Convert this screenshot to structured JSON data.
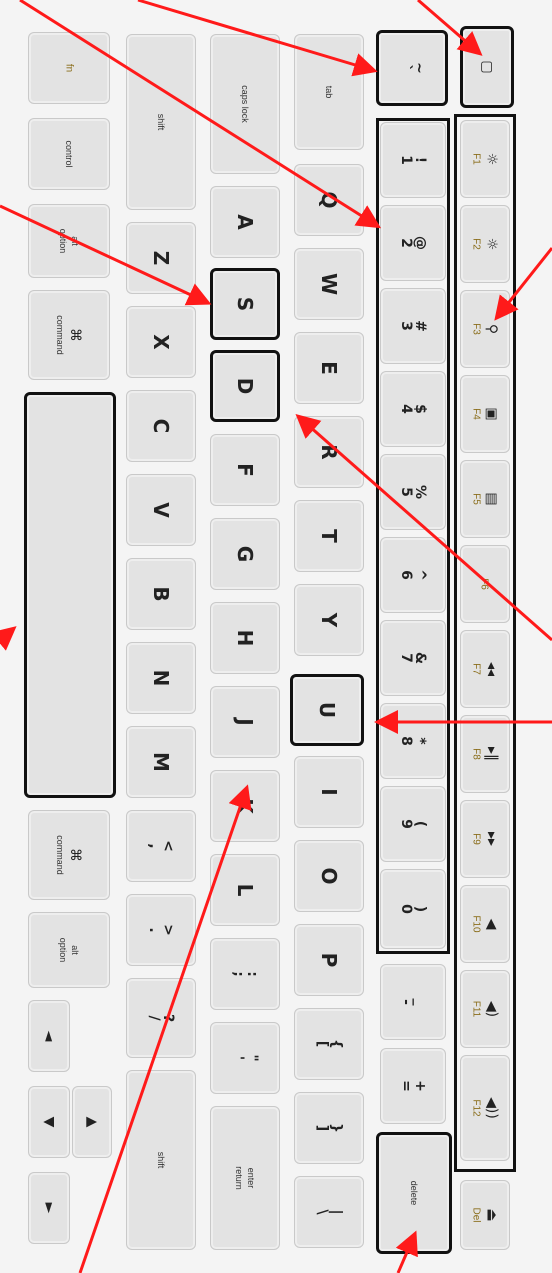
{
  "colors": {
    "arrow": "#ff1a1a",
    "outline": "#111111",
    "key_face": "#e3e3e3",
    "fn_label": "#8a6d1a"
  },
  "keys": {
    "fn": "fn",
    "control": "control",
    "option_left": "option",
    "alt_left": "alt",
    "command_left": "command",
    "cmd_glyph": "⌘",
    "space": "",
    "command_right": "command",
    "option_right": "option",
    "alt_right": "alt",
    "arrow_left": "◄",
    "arrow_up": "▲",
    "arrow_down": "▼",
    "arrow_right": "►",
    "shift_left": "shift",
    "shift_right": "shift",
    "z": "Z",
    "x": "X",
    "c": "C",
    "v": "V",
    "b": "B",
    "n": "N",
    "m": "M",
    "comma": "<",
    "comma_b": ",",
    "period": ">",
    "period_b": ".",
    "slash": "?",
    "slash_b": "/",
    "caps_lock": "caps lock",
    "a": "A",
    "s": "S",
    "d": "D",
    "f": "F",
    "g": "G",
    "h": "H",
    "j": "J",
    "k": "K",
    "l": "L",
    "semicolon": ":",
    "semicolon_b": ";",
    "quote": "\"",
    "quote_b": "'",
    "return_top": "enter",
    "return_bottom": "return",
    "tab": "tab",
    "q": "Q",
    "w": "W",
    "e": "E",
    "r": "R",
    "t": "T",
    "y": "Y",
    "u": "U",
    "i": "I",
    "o": "O",
    "p": "P",
    "lbracket": "{",
    "lbracket_b": "[",
    "rbracket": "}",
    "rbracket_b": "]",
    "backslash": "|",
    "backslash_b": "\\",
    "tilde": "~",
    "tilde_b": "`",
    "n1": "!",
    "n1_b": "1",
    "n2": "@",
    "n2_b": "2",
    "n3": "#",
    "n3_b": "3",
    "n4": "$",
    "n4_b": "4",
    "n5": "%",
    "n5_b": "5",
    "n6": "^",
    "n6_b": "6",
    "n7": "&",
    "n7_b": "7",
    "n8": "*",
    "n8_b": "8",
    "n9": "(",
    "n9_b": "9",
    "n0": ")",
    "n0_b": "0",
    "minus": "_",
    "minus_b": "-",
    "equals": "+",
    "equals_b": "=",
    "delete": "delete",
    "eject_glyph": "▢",
    "del": "Del",
    "del_icon": "⏏",
    "f1": "F1",
    "f1_icon": "☼",
    "f2": "F2",
    "f2_icon": "☼",
    "f3": "F3",
    "f3_icon": "⚲",
    "f4": "F4",
    "f4_icon": "▣",
    "f5": "F5",
    "f5_icon": "▤",
    "f6": "F6",
    "f6_icon": "",
    "f7": "F7",
    "f7_icon": "◂◂",
    "f8": "F8",
    "f8_icon": "▸‖",
    "f9": "F9",
    "f9_icon": "▸▸",
    "f10": "F10",
    "f10_icon": "◀",
    "f11": "F11",
    "f11_icon": "◀)",
    "f12": "F12",
    "f12_icon": "◀))"
  }
}
